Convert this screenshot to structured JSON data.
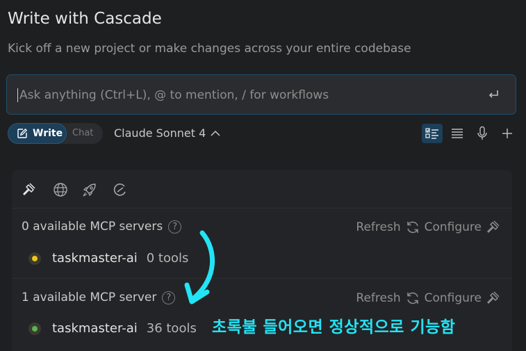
{
  "header": {
    "title": "Write with Cascade",
    "subtitle": "Kick off a new project or make changes across your entire codebase"
  },
  "input": {
    "placeholder": "Ask anything (Ctrl+L), @ to mention, / for workflows",
    "value": ""
  },
  "toolbar": {
    "write_label": "Write",
    "chat_label": "Chat",
    "model_label": "Claude Sonnet 4",
    "active_mode": "Write"
  },
  "panel": {
    "tabs": [
      "hammer-icon",
      "globe-icon",
      "rocket-icon",
      "windsurf-icon"
    ],
    "sections": [
      {
        "title": "0 available MCP servers",
        "refresh_label": "Refresh",
        "configure_label": "Configure",
        "server": {
          "name": "taskmaster-ai",
          "tools": "0 tools",
          "status_color": "#f0c419"
        }
      },
      {
        "title": "1 available MCP server",
        "refresh_label": "Refresh",
        "configure_label": "Configure",
        "server": {
          "name": "taskmaster-ai",
          "tools": "36 tools",
          "status_color": "#5bb450"
        }
      }
    ]
  },
  "annotation": {
    "text": "초록불 들어오면 정상적으로 기능함",
    "color": "#22e4f5"
  },
  "colors": {
    "background": "#1e1f21",
    "accent": "#1c3f5a",
    "input_border": "#1f4f6e"
  }
}
